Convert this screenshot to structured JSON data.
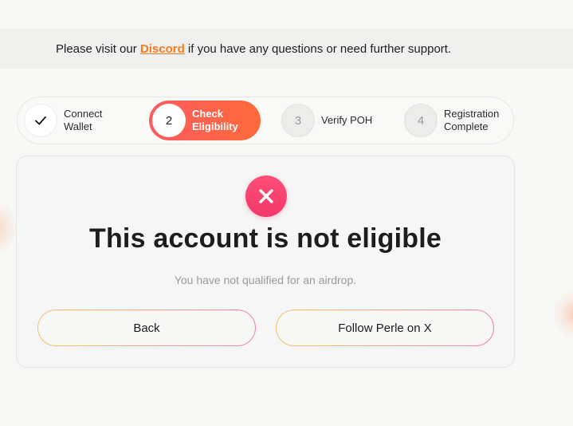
{
  "banner": {
    "prefix": "Please visit our ",
    "link_label": "Discord",
    "suffix": " if you have any questions or need further support."
  },
  "stepper": {
    "steps": [
      {
        "badge": "",
        "icon": "check-icon",
        "line1": "Connect",
        "line2": "Wallet",
        "state": "complete"
      },
      {
        "badge": "2",
        "line1": "Check",
        "line2": "Eligibility",
        "state": "active"
      },
      {
        "badge": "3",
        "line1": "Verify POH",
        "line2": "",
        "state": "pending"
      },
      {
        "badge": "4",
        "line1": "Registration",
        "line2": "Complete",
        "state": "pending"
      }
    ]
  },
  "result": {
    "icon": "close-icon",
    "title": "This account is not eligible",
    "subtitle": "You have not qualified for an airdrop.",
    "back_label": "Back",
    "follow_label": "Follow Perle on X"
  },
  "colors": {
    "accent_orange": "#f47a20",
    "active_step_gradient_start": "#ff5a5f",
    "active_step_gradient_end": "#ff6a3a",
    "error_badge": "#f2376a"
  }
}
